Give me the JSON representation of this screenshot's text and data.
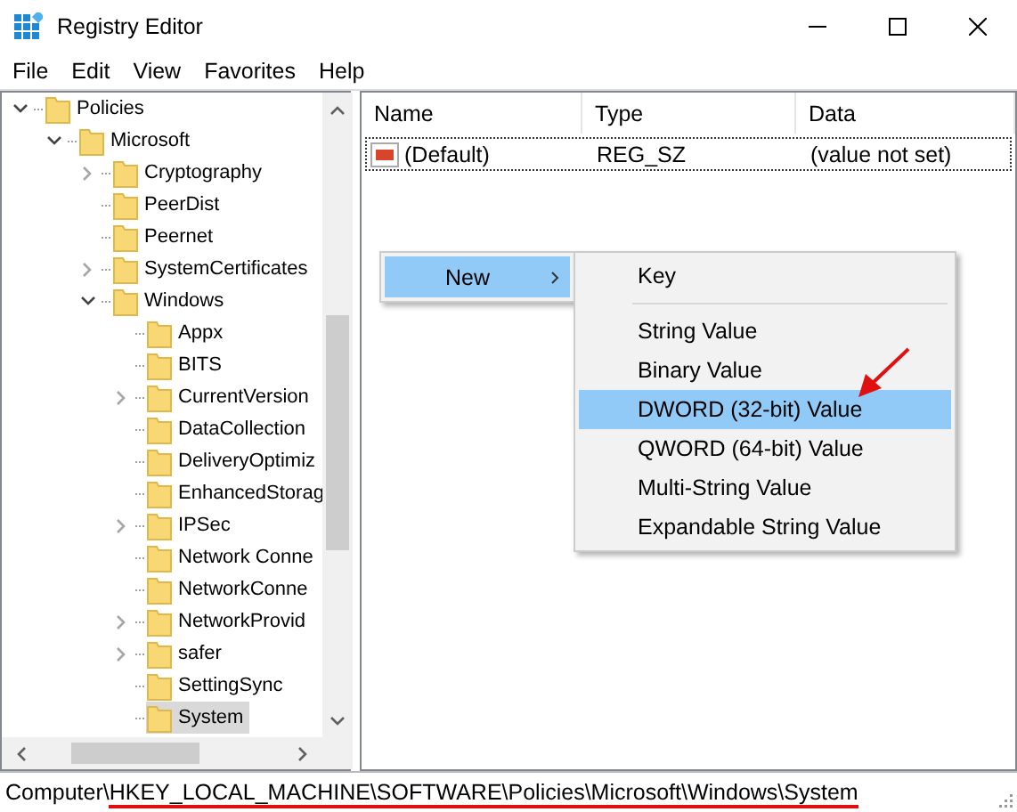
{
  "window": {
    "title": "Registry Editor"
  },
  "menu": [
    "File",
    "Edit",
    "View",
    "Favorites",
    "Help"
  ],
  "tree": [
    {
      "label": "Policies",
      "has_children": true,
      "expanded": true,
      "selected": false,
      "children": [
        {
          "label": "Microsoft",
          "has_children": true,
          "expanded": true,
          "selected": false,
          "children": [
            {
              "label": "Cryptography",
              "has_children": true,
              "expanded": false,
              "selected": false
            },
            {
              "label": "PeerDist",
              "has_children": false,
              "selected": false
            },
            {
              "label": "Peernet",
              "has_children": false,
              "selected": false
            },
            {
              "label": "SystemCertificates",
              "has_children": true,
              "expanded": false,
              "selected": false
            },
            {
              "label": "Windows",
              "has_children": true,
              "expanded": true,
              "selected": false,
              "children": [
                {
                  "label": "Appx",
                  "has_children": false,
                  "selected": false
                },
                {
                  "label": "BITS",
                  "has_children": false,
                  "selected": false
                },
                {
                  "label": "CurrentVersion",
                  "has_children": true,
                  "expanded": false,
                  "selected": false
                },
                {
                  "label": "DataCollection",
                  "has_children": false,
                  "selected": false
                },
                {
                  "label": "DeliveryOptimiz",
                  "has_children": false,
                  "selected": false
                },
                {
                  "label": "EnhancedStorag",
                  "has_children": false,
                  "selected": false
                },
                {
                  "label": "IPSec",
                  "has_children": true,
                  "expanded": false,
                  "selected": false
                },
                {
                  "label": "Network Conne",
                  "has_children": false,
                  "selected": false
                },
                {
                  "label": "NetworkConne",
                  "has_children": false,
                  "selected": false
                },
                {
                  "label": "NetworkProvid",
                  "has_children": true,
                  "expanded": false,
                  "selected": false
                },
                {
                  "label": "safer",
                  "has_children": true,
                  "expanded": false,
                  "selected": false
                },
                {
                  "label": "SettingSync",
                  "has_children": false,
                  "selected": false
                },
                {
                  "label": "System",
                  "has_children": false,
                  "selected": true
                }
              ]
            }
          ]
        }
      ]
    }
  ],
  "table": {
    "columns": [
      "Name",
      "Type",
      "Data"
    ],
    "rows": [
      {
        "name": "(Default)",
        "type": "REG_SZ",
        "data": "(value not set)",
        "focused": true
      }
    ]
  },
  "context_menu": {
    "items": [
      {
        "label": "New",
        "selected": true,
        "has_submenu": true
      }
    ]
  },
  "submenu": {
    "items": [
      {
        "kind": "item",
        "label": "Key",
        "selected": false
      },
      {
        "kind": "separator"
      },
      {
        "kind": "item",
        "label": "String Value",
        "selected": false
      },
      {
        "kind": "item",
        "label": "Binary Value",
        "selected": false
      },
      {
        "kind": "item",
        "label": "DWORD (32-bit) Value",
        "selected": true
      },
      {
        "kind": "item",
        "label": "QWORD (64-bit) Value",
        "selected": false
      },
      {
        "kind": "item",
        "label": "Multi-String Value",
        "selected": false
      },
      {
        "kind": "item",
        "label": "Expandable String Value",
        "selected": false
      }
    ]
  },
  "status_bar": {
    "root": "Computer\\",
    "path": "HKEY_LOCAL_MACHINE\\SOFTWARE\\Policies\\Microsoft\\Windows\\System"
  }
}
